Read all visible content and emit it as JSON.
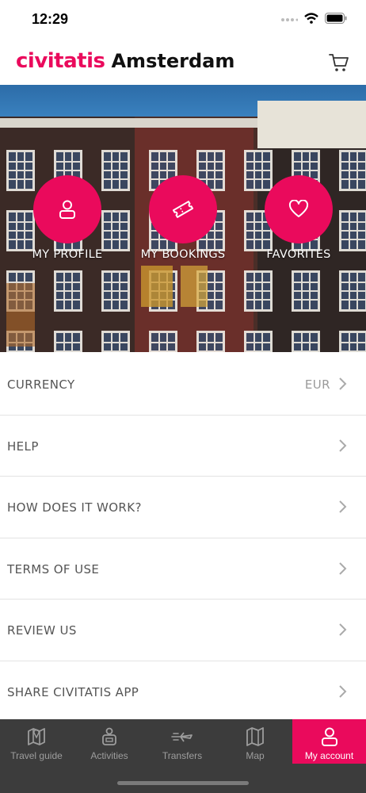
{
  "status_bar": {
    "time": "12:29"
  },
  "header": {
    "brand": "civitatis",
    "city": "Amsterdam"
  },
  "hero_actions": [
    {
      "label": "MY PROFILE",
      "icon": "person-icon"
    },
    {
      "label": "MY BOOKINGS",
      "icon": "ticket-icon"
    },
    {
      "label": "FAVORITES",
      "icon": "heart-icon"
    }
  ],
  "menu": [
    {
      "label": "CURRENCY",
      "value": "EUR"
    },
    {
      "label": "HELP"
    },
    {
      "label": "HOW DOES IT WORK?"
    },
    {
      "label": "TERMS OF USE"
    },
    {
      "label": "REVIEW US"
    },
    {
      "label": "SHARE CIVITATIS APP"
    }
  ],
  "tabs": [
    {
      "label": "Travel guide",
      "icon": "guide-map-icon"
    },
    {
      "label": "Activities",
      "icon": "activities-icon"
    },
    {
      "label": "Transfers",
      "icon": "transfers-icon"
    },
    {
      "label": "Map",
      "icon": "map-icon"
    },
    {
      "label": "My account",
      "icon": "account-icon",
      "active": true
    }
  ],
  "colors": {
    "brand": "#ea0a5c",
    "tabbar": "#3c3c3c",
    "text": "#555555"
  }
}
